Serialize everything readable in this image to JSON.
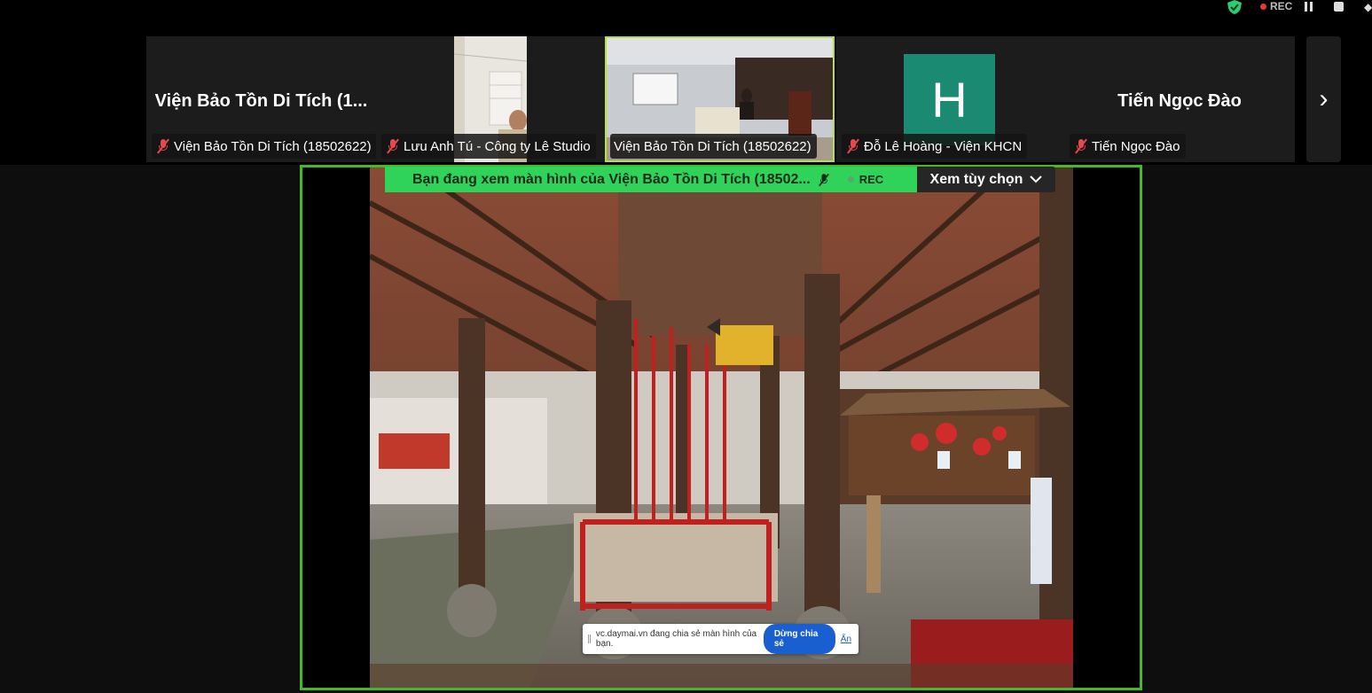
{
  "top_bar": {
    "rec_label": "REC"
  },
  "gallery": {
    "tiles": [
      {
        "big_name": "Viện Bảo Tồn Di Tích (1...",
        "label": "Viện Bảo Tồn Di Tích (18502622)",
        "muted": true
      },
      {
        "big_name": "",
        "label": "Lưu Anh Tú - Công ty Lê Studio",
        "muted": true
      },
      {
        "big_name": "",
        "label": "Viện Bảo Tồn Di Tích (18502622)",
        "muted": false
      },
      {
        "avatar_letter": "H",
        "label": "Đỗ Lê Hoàng - Viện KHCN",
        "muted": true
      },
      {
        "big_name": "Tiến Ngọc Đào",
        "label": "Tiến Ngọc Đào",
        "muted": true
      }
    ]
  },
  "share": {
    "banner_text": "Bạn đang xem màn hình của  Viện Bảo Tồn Di Tích (18502...",
    "banner_rec": "REC",
    "view_options": "Xem tùy chọn"
  },
  "chrome_notice": {
    "text": "vc.daymai.vn đang chia sẻ màn hình của bạn.",
    "stop_label": "Dừng chia sẻ",
    "hide_label": "Ẩn"
  },
  "colors": {
    "share_border": "#49b72a",
    "banner_bg": "#2fd35a",
    "active_tile_border": "#b7df4b",
    "avatar_bg": "#1a8a72"
  }
}
